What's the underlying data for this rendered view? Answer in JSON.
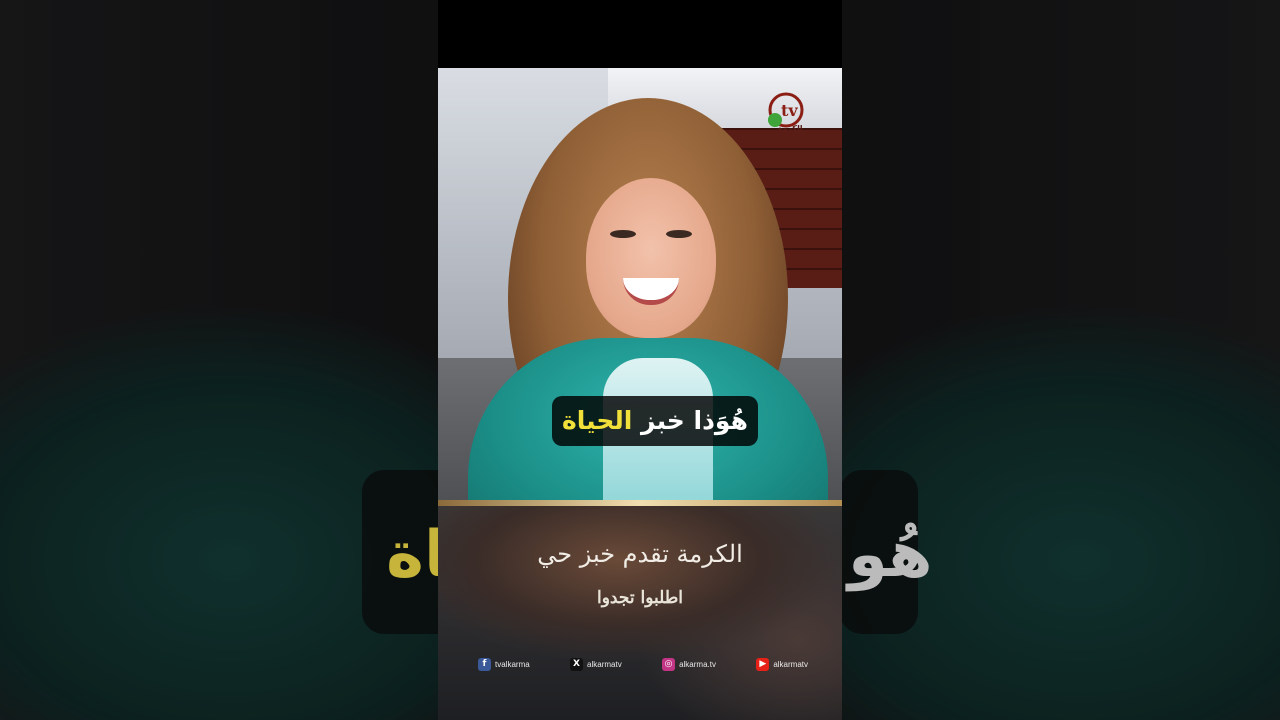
{
  "subtitle": {
    "white_text": "هُوَذا خبز",
    "highlight_text": "الحياة",
    "highlight_color": "#f2e03a"
  },
  "logo": {
    "letters": "tv",
    "channel_name": "الكرمة"
  },
  "banner": {
    "title": "الكرمة تقدم خبز حي",
    "subtitle": "اطلبوا تجدوا"
  },
  "socials": [
    {
      "icon": "facebook-icon",
      "glyph": "f",
      "color": "#3b5998",
      "label": "tvalkarma"
    },
    {
      "icon": "x-icon",
      "glyph": "X",
      "color": "#111111",
      "label": "alkarmatv"
    },
    {
      "icon": "instagram-icon",
      "glyph": "◎",
      "color": "#c13584",
      "label": "alkarma.tv"
    },
    {
      "icon": "youtube-icon",
      "glyph": "▶",
      "color": "#e62117",
      "label": "alkarmatv"
    }
  ],
  "background_caption": {
    "left_fragment": "ياة",
    "right_fragment": "هُو"
  }
}
